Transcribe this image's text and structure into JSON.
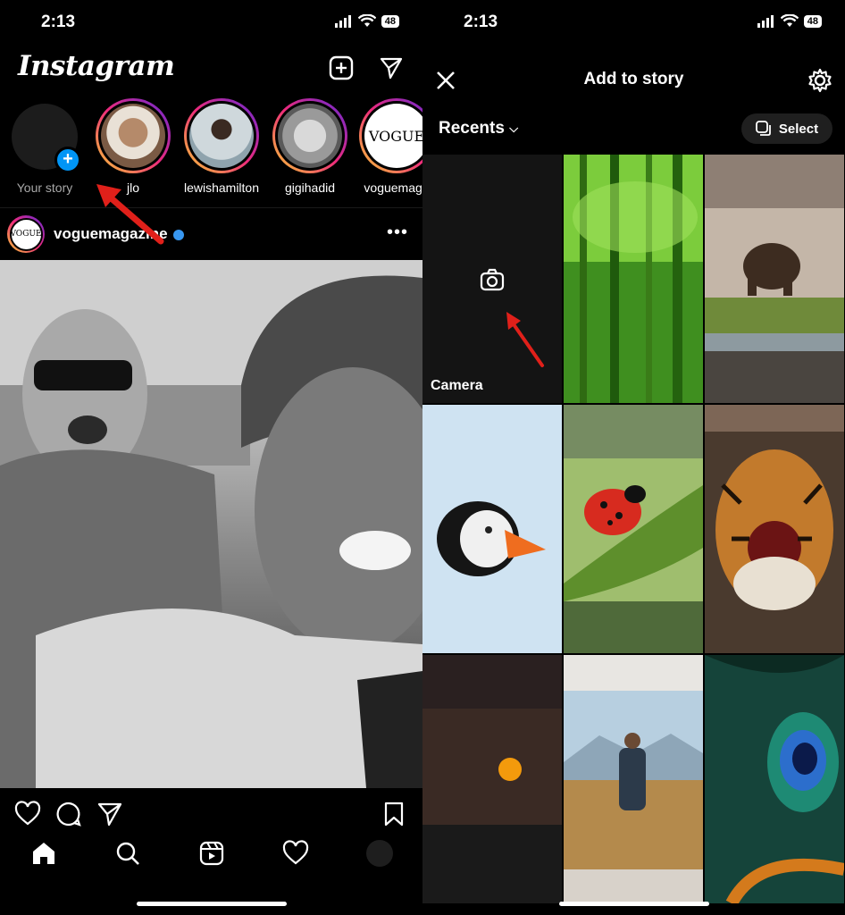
{
  "left": {
    "status": {
      "time": "2:13",
      "battery": "48"
    },
    "app_logo": "Instagram",
    "stories": [
      {
        "label": "Your story",
        "own": true
      },
      {
        "label": "jlo"
      },
      {
        "label": "lewishamilton"
      },
      {
        "label": "gigihadid"
      },
      {
        "label": "voguemaga"
      }
    ],
    "post": {
      "username": "voguemagazine",
      "avatar_text": "VOGUE",
      "vogue_story_text": "VOGUE"
    }
  },
  "right": {
    "status": {
      "time": "2:13",
      "battery": "48"
    },
    "title": "Add to story",
    "recents_label": "Recents",
    "select_label": "Select",
    "camera_label": "Camera"
  },
  "colors": {
    "accent_blue": "#0095f6",
    "annotation_red": "#e0201a",
    "story_ring_start": "#f9ce34",
    "story_ring_end": "#6228d7"
  }
}
